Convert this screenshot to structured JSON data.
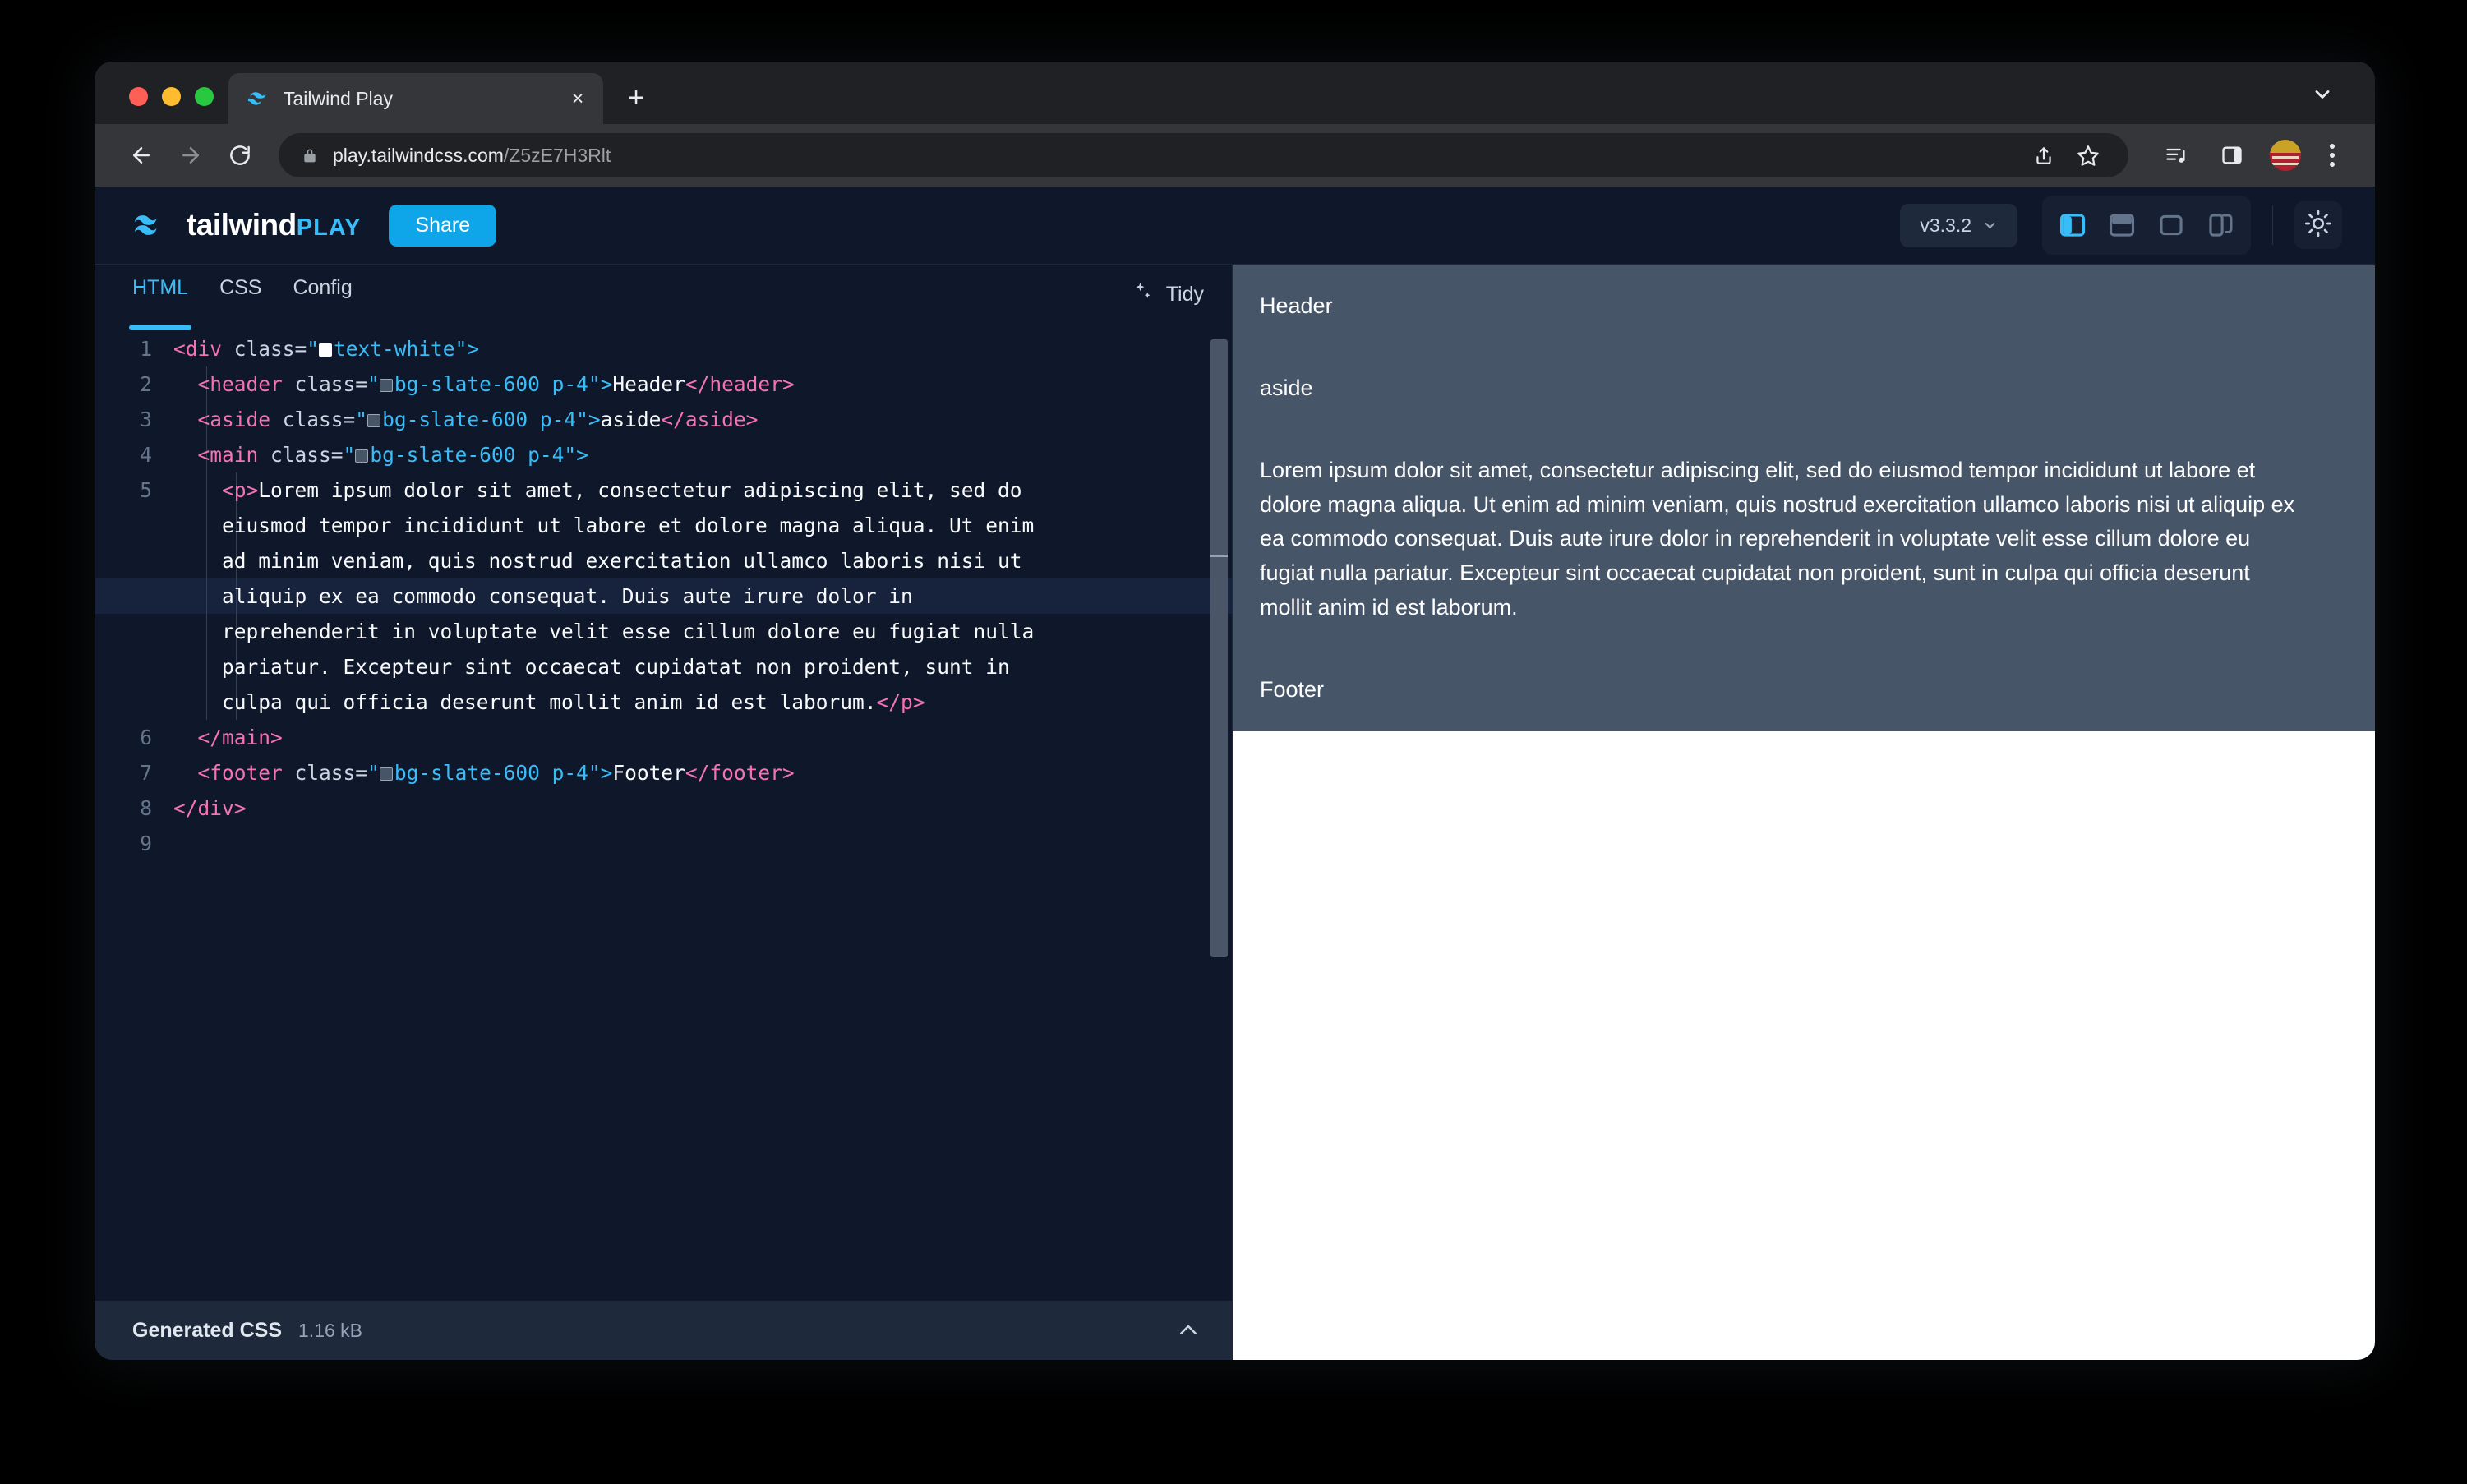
{
  "browser": {
    "tab": {
      "title": "Tailwind Play",
      "favicon": "tailwind-logo-icon",
      "close": "×"
    },
    "new_tab_label": "+",
    "omnibox": {
      "url_domain": "play.tailwindcss.com",
      "url_path": "/Z5zE7H3Rlt",
      "lock": "lock-icon"
    },
    "toolbar_icons": [
      "back-icon",
      "forward-icon",
      "reload-icon",
      "share-icon",
      "bookmark-star-icon",
      "media-list-icon",
      "side-panel-icon",
      "profile-avatar",
      "more-menu-icon"
    ]
  },
  "app": {
    "brand": {
      "name": "tailwind",
      "suffix": "PLAY"
    },
    "share_label": "Share",
    "version": {
      "label": "v3.3.2"
    },
    "layout_buttons": [
      {
        "name": "layout-split-vertical",
        "active": true
      },
      {
        "name": "layout-split-horizontal",
        "active": false
      },
      {
        "name": "layout-preview-only",
        "active": false
      },
      {
        "name": "layout-responsive",
        "active": false
      }
    ],
    "theme_toggle": "sun-icon"
  },
  "editor": {
    "tabs": [
      {
        "label": "HTML",
        "active": true
      },
      {
        "label": "CSS",
        "active": false
      },
      {
        "label": "Config",
        "active": false
      }
    ],
    "tidy_label": "Tidy",
    "lines": [
      {
        "n": "1"
      },
      {
        "n": "2"
      },
      {
        "n": "3"
      },
      {
        "n": "4"
      },
      {
        "n": "5"
      },
      {
        "n": ""
      },
      {
        "n": ""
      },
      {
        "n": ""
      },
      {
        "n": ""
      },
      {
        "n": ""
      },
      {
        "n": ""
      },
      {
        "n": "6"
      },
      {
        "n": "7"
      },
      {
        "n": "8"
      },
      {
        "n": "9"
      }
    ],
    "code": {
      "l1_tag_open": "<div",
      "l1_attr": " class=",
      "l1_quote_open": "\"",
      "l1_class": "text-white",
      "l1_quote_close": "\">",
      "l2_tag_open": "<header",
      "l2_class": "bg-slate-600 p-4",
      "l2_text": "Header",
      "l2_tag_close": "</header>",
      "l3_tag_open": "<aside",
      "l3_class": "bg-slate-600 p-4",
      "l3_text": "aside",
      "l3_tag_close": "</aside>",
      "l4_tag_open": "<main",
      "l4_class": "bg-slate-600 p-4",
      "l5_p_open": "<p>",
      "l5_text_1": "Lorem ipsum dolor sit amet, consectetur adipiscing elit, sed do",
      "l5_text_2": "eiusmod tempor incididunt ut labore et dolore magna aliqua. Ut enim",
      "l5_text_3": "ad minim veniam, quis nostrud exercitation ullamco laboris nisi ut",
      "l5_text_4": "aliquip ex ea commodo consequat. Duis aute irure dolor in",
      "l5_text_5": "reprehenderit in voluptate velit esse cillum dolore eu fugiat nulla",
      "l5_text_6": "pariatur. Excepteur sint occaecat cupidatat non proident, sunt in",
      "l5_text_7": "culpa qui officia deserunt mollit anim id est laborum.",
      "l5_p_close": "</p>",
      "l6_tag_close": "</main>",
      "l7_tag_open": "<footer",
      "l7_class": "bg-slate-600 p-4",
      "l7_text": "Footer",
      "l7_tag_close": "</footer>",
      "l8_tag_close": "</div>"
    },
    "generated_css": {
      "label": "Generated CSS",
      "size": "1.16 kB",
      "toggle": "chevron-up-icon"
    }
  },
  "preview": {
    "header_text": "Header",
    "aside_text": "aside",
    "main_paragraph": "Lorem ipsum dolor sit amet, consectetur adipiscing elit, sed do eiusmod tempor incididunt ut labore et dolore magna aliqua. Ut enim ad minim veniam, quis nostrud exercitation ullamco laboris nisi ut aliquip ex ea commodo consequat. Duis aute irure dolor in reprehenderit in voluptate velit esse cillum dolore eu fugiat nulla pariatur. Excepteur sint occaecat cupidatat non proident, sunt in culpa qui officia deserunt mollit anim id est laborum.",
    "footer_text": "Footer"
  },
  "colors": {
    "accent_sky": "#38bdf8",
    "share_button": "#0ea5e9",
    "app_bg": "#0f172a",
    "panel_bg": "#1e293b",
    "preview_block": "#475569",
    "tag_pink": "#f472b6",
    "string_sky": "#38bdf8"
  }
}
